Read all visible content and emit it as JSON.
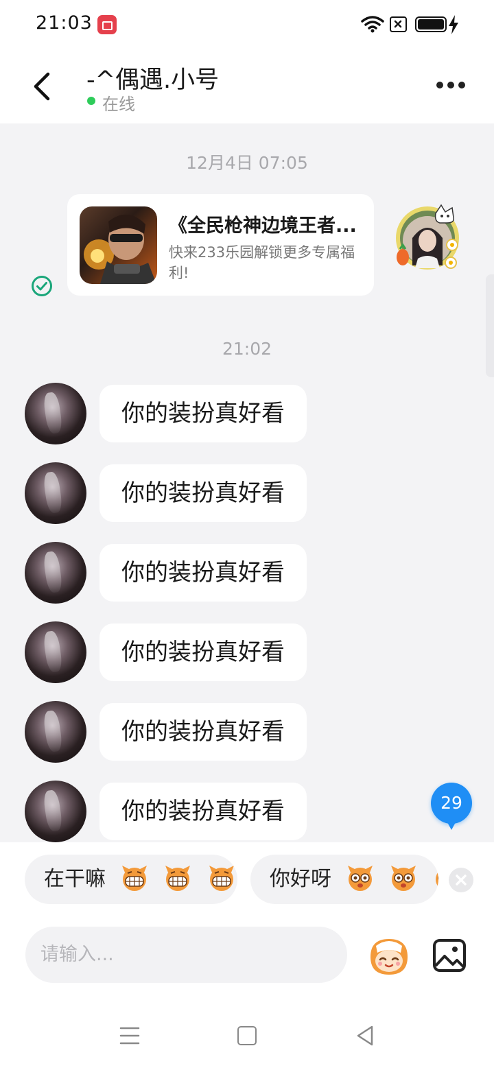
{
  "status_bar": {
    "time": "21:03",
    "icons": [
      "screen-record-icon",
      "wifi-icon",
      "sim-off-icon",
      "battery-icon",
      "charging-icon"
    ]
  },
  "header": {
    "title": "-^偶遇.小号",
    "status": "在线",
    "status_color": "#2ecc5a"
  },
  "chat": {
    "timestamps": [
      "12月4日 07:05",
      "21:02"
    ],
    "game_card": {
      "title": "《全民枪神边境王者...",
      "description": "快来233乐园解锁更多专属福利!"
    },
    "messages": [
      {
        "text": "你的装扮真好看"
      },
      {
        "text": "你的装扮真好看"
      },
      {
        "text": "你的装扮真好看"
      },
      {
        "text": "你的装扮真好看"
      },
      {
        "text": "你的装扮真好看"
      },
      {
        "text": "你的装扮真好看"
      }
    ],
    "unread_count": "29",
    "accent_color": "#1f8ef5"
  },
  "quick_replies": [
    {
      "text": "在干嘛"
    },
    {
      "text": "你好呀"
    }
  ],
  "composer": {
    "placeholder": "请输入..."
  },
  "nav_bar": {
    "icons": [
      "menu-icon",
      "home-icon",
      "back-icon"
    ]
  }
}
